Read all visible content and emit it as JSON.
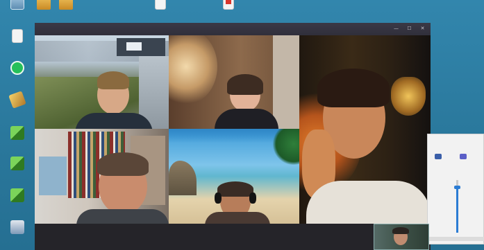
{
  "desktop": {
    "top_icons": [
      {
        "name": "this-pc",
        "glyph": "pc",
        "label": ""
      },
      {
        "name": "folder-1",
        "glyph": "folder",
        "label": ""
      },
      {
        "name": "folder-2",
        "glyph": "folder",
        "label": ""
      },
      {
        "name": "document",
        "glyph": "doc",
        "label": ""
      },
      {
        "name": "pdf-file",
        "glyph": "pdf",
        "label": ""
      }
    ],
    "left_icons": [
      {
        "name": "document-shortcut",
        "glyph": "doc",
        "label": ""
      },
      {
        "name": "whatsapp",
        "glyph": "wa",
        "label": ""
      },
      {
        "name": "tool-shortcut",
        "glyph": "tool",
        "label": ""
      },
      {
        "name": "minecraft-1",
        "glyph": "cube",
        "label": ""
      },
      {
        "name": "minecraft-2",
        "glyph": "cube",
        "label": ""
      },
      {
        "name": "minecraft-3",
        "glyph": "cube",
        "label": ""
      },
      {
        "name": "app-shortcut",
        "glyph": "app",
        "label": ""
      }
    ]
  },
  "window": {
    "controls": {
      "minimize": "—",
      "maximize": "☐",
      "close": "✕"
    },
    "participants": [
      {
        "name": "participant-office-view"
      },
      {
        "name": "participant-woman-lamp"
      },
      {
        "name": "participant-man-hand-on-chin"
      },
      {
        "name": "participant-bookshelf"
      },
      {
        "name": "participant-beach-headset"
      }
    ]
  },
  "volume_flyout": {
    "level_fraction": 0.85,
    "accent": "#2b7cd3"
  },
  "colors": {
    "desktop": "#2f7ea2",
    "window_bg": "#1f1f24",
    "titlebar": "#34333f"
  }
}
